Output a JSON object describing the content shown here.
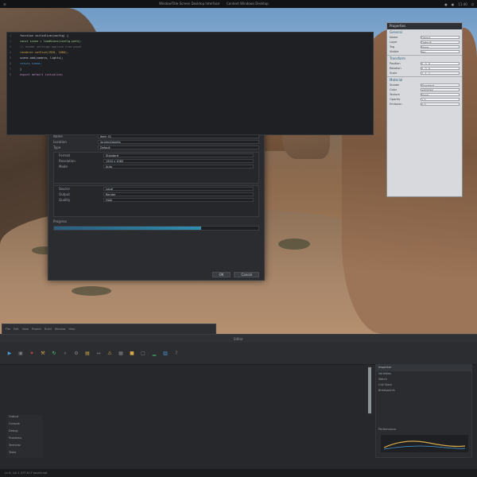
{
  "topbar": {
    "menu": [
      "☰"
    ],
    "title": "WindowTitle   Screen   Desktop   Interface",
    "title2": "Content   Windows   Desktop",
    "right_icons": [
      "bell-icon",
      "user-icon",
      "power-icon"
    ],
    "clock": "11:40"
  },
  "dialog": {
    "tab": "Settings",
    "close": "×",
    "rows": [
      {
        "label": "Name",
        "value": "item_01"
      },
      {
        "label": "Location",
        "value": "/project/assets"
      },
      {
        "label": "Type",
        "value": "Default"
      },
      {
        "label": "Format",
        "value": "Standard"
      },
      {
        "label": "Resolution",
        "value": "1920 x 1080"
      },
      {
        "label": "Mode",
        "value": "Auto"
      },
      {
        "label": "Source",
        "value": "Local"
      },
      {
        "label": "Output",
        "value": "Render"
      },
      {
        "label": "Quality",
        "value": "High"
      }
    ],
    "progress": 0.72,
    "progress_label": "Progress",
    "buttons": {
      "ok": "OK",
      "cancel": "Cancel"
    }
  },
  "rpanel": {
    "header": "Properties",
    "sections": [
      {
        "title": "General",
        "rows": [
          {
            "label": "Name",
            "value": "Object"
          },
          {
            "label": "Layer",
            "value": "Default"
          },
          {
            "label": "Tag",
            "value": "None"
          },
          {
            "label": "Visible",
            "value": "Yes"
          }
        ]
      },
      {
        "title": "Transform",
        "rows": [
          {
            "label": "Position",
            "value": "0, 0, 0"
          },
          {
            "label": "Rotation",
            "value": "0, 0, 0"
          },
          {
            "label": "Scale",
            "value": "1, 1, 1"
          }
        ]
      },
      {
        "title": "Material",
        "rows": [
          {
            "label": "Shader",
            "value": "Standard"
          },
          {
            "label": "Color",
            "value": "#FFFFFF"
          },
          {
            "label": "Texture",
            "value": "None"
          },
          {
            "label": "Opacity",
            "value": "1.0"
          },
          {
            "label": "Emission",
            "value": "0.0"
          }
        ]
      }
    ]
  },
  "small_window": {
    "items": [
      "File",
      "Edit",
      "View",
      "Project",
      "Build",
      "Window",
      "Help"
    ]
  },
  "editor": {
    "title": "Editor",
    "tools": [
      {
        "name": "run-icon",
        "glyph": "▶",
        "color": "#4a9bd6"
      },
      {
        "name": "save-icon",
        "glyph": "▣",
        "color": "#7c8189"
      },
      {
        "name": "debug-icon",
        "glyph": "✦",
        "color": "#d64a4a"
      },
      {
        "name": "build-icon",
        "glyph": "⚒",
        "color": "#d6a84a"
      },
      {
        "name": "refresh-icon",
        "glyph": "↻",
        "color": "#4ad67a"
      },
      {
        "name": "search-icon",
        "glyph": "⌕",
        "color": "#7c8189"
      },
      {
        "name": "settings-icon",
        "glyph": "⚙",
        "color": "#7c8189"
      },
      {
        "name": "layers-icon",
        "glyph": "▤",
        "color": "#d6a84a"
      },
      {
        "name": "link-icon",
        "glyph": "↔",
        "color": "#7c8189"
      },
      {
        "name": "warning-icon",
        "glyph": "⚠",
        "color": "#d6a84a"
      },
      {
        "name": "grid-icon",
        "glyph": "▦",
        "color": "#7c8189"
      },
      {
        "name": "folder-icon",
        "glyph": "■",
        "color": "#d6a84a"
      },
      {
        "name": "terminal-icon",
        "glyph": "□",
        "color": "#7c8189"
      },
      {
        "name": "chart-icon",
        "glyph": "▁",
        "color": "#4ad67a"
      },
      {
        "name": "layout-icon",
        "glyph": "▥",
        "color": "#4a9bd6"
      },
      {
        "name": "help-icon",
        "glyph": "?",
        "color": "#7c8189"
      }
    ],
    "code_lines": [
      {
        "num": "1",
        "text": "function initialize(config) {",
        "color": "#c8ccd2"
      },
      {
        "num": "2",
        "text": "  const scene = loadScene(config.path);",
        "color": "#9ec98a"
      },
      {
        "num": "3",
        "text": "  // render settings applied from panel",
        "color": "#6a737d"
      },
      {
        "num": "4",
        "text": "  renderer.setSize(1920, 1080);",
        "color": "#d6a84a"
      },
      {
        "num": "5",
        "text": "  scene.add(camera, lights);",
        "color": "#c8ccd2"
      },
      {
        "num": "6",
        "text": "  return scene;",
        "color": "#4a9bd6"
      },
      {
        "num": "7",
        "text": "}",
        "color": "#c8ccd2"
      },
      {
        "num": "8",
        "text": "export default initialize;",
        "color": "#c98ac9"
      }
    ],
    "gutter": [
      "Output",
      "Console",
      "Debug",
      "Problems",
      "Terminal",
      "Tasks"
    ],
    "side": {
      "header": "Inspector",
      "sections": [
        "Variables",
        "Watch",
        "Call Stack",
        "Breakpoints"
      ],
      "graph_label": "Performance"
    },
    "status": "Ln 8, Col 1   UTF-8   LF   JavaScript"
  }
}
